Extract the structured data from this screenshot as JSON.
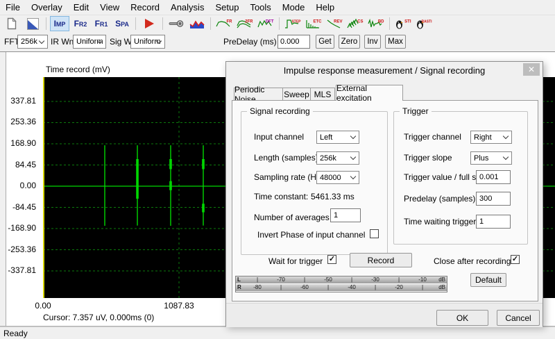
{
  "menu": {
    "items": [
      "File",
      "Overlay",
      "Edit",
      "View",
      "Record",
      "Analysis",
      "Setup",
      "Tools",
      "Mode",
      "Help"
    ]
  },
  "toolbar": {
    "buttons": [
      {
        "kind": "doc",
        "name": "new-document-icon"
      },
      {
        "kind": "scale",
        "name": "scale-icon"
      },
      {
        "kind": "sep"
      },
      {
        "kind": "text",
        "name": "imp-mode-button",
        "label": "IMP",
        "active": true
      },
      {
        "kind": "text",
        "name": "fr2-mode-button",
        "label": "FR2"
      },
      {
        "kind": "text",
        "name": "fr1-mode-button",
        "label": "FR1"
      },
      {
        "kind": "text",
        "name": "spa-mode-button",
        "label": "SPA"
      },
      {
        "kind": "sep"
      },
      {
        "kind": "play",
        "name": "play-record-button"
      },
      {
        "kind": "sep"
      },
      {
        "kind": "mic",
        "name": "microphone-icon"
      },
      {
        "kind": "wave",
        "name": "signal-generator-icon"
      },
      {
        "kind": "sep"
      },
      {
        "kind": "chart",
        "name": "fr-smoothed-button",
        "label": "FR"
      },
      {
        "kind": "chart",
        "name": "fr-overlay-button",
        "label": "2FR"
      },
      {
        "kind": "chart",
        "name": "dft-button",
        "label": "DFT",
        "label_color": "#a000a0"
      },
      {
        "kind": "sep"
      },
      {
        "kind": "chart",
        "name": "step-response-button",
        "label": "STEP"
      },
      {
        "kind": "chart",
        "name": "etc-button",
        "label": "ETC"
      },
      {
        "kind": "chart",
        "name": "reverberation-button",
        "label": "REV"
      },
      {
        "kind": "chart",
        "name": "cumulative-spectrum-button",
        "label": "CS"
      },
      {
        "kind": "chart",
        "name": "burst-decay-button",
        "label": "BD"
      },
      {
        "kind": "sep"
      },
      {
        "kind": "penguin",
        "name": "sti-button",
        "label": "STI"
      },
      {
        "kind": "penguin",
        "name": "rasti-button",
        "label": "RASTI"
      }
    ]
  },
  "settings_bar": {
    "fft_label": "FFT",
    "fft_value": "256k",
    "ir_wnd_label": "IR Wnd",
    "ir_wnd_value": "Uniform",
    "sig_wnd_label": "Sig Wnd",
    "sig_wnd_value": "Uniform",
    "predelay_label": "PreDelay (ms)",
    "predelay_value": "0.000",
    "get_label": "Get",
    "zero_label": "Zero",
    "inv_label": "Inv",
    "max_label": "Max"
  },
  "chart_data": {
    "type": "line",
    "title": "Time record (mV)",
    "xlabel": "",
    "ylabel": "mV",
    "y_ticks": [
      "337.81",
      "253.36",
      "168.90",
      "84.45",
      "0.00",
      "-84.45",
      "-168.90",
      "-253.36",
      "-337.81"
    ],
    "x_ticks": [
      {
        "label": "0.00",
        "frac": 0.0
      },
      {
        "label": "1087.83",
        "frac": 0.2656
      }
    ],
    "ylim": [
      -445,
      434
    ],
    "grid": true,
    "legend": "none",
    "cursor_readout": "Cursor: 7.357 uV, 0.000ms (0)",
    "cursor_frac": 0.0,
    "vertical_gridline_frac": 0.2656,
    "colors": {
      "background": "#000000",
      "grid": "#0c7a0c",
      "trace": "#00d800",
      "cursor": "#d4d400"
    },
    "spikes": [
      {
        "frac": 0.1206,
        "top_mV": 163,
        "bottom_mV": -158,
        "thick": []
      },
      {
        "frac": 0.1843,
        "top_mV": 163,
        "bottom_mV": -157,
        "thick": [
          [
            108,
            -50
          ]
        ]
      },
      {
        "frac": 0.2493,
        "top_mV": 163,
        "bottom_mV": -158,
        "thick": [
          [
            108,
            68
          ],
          [
            20,
            -16
          ]
        ]
      },
      {
        "frac": 0.313,
        "top_mV": 163,
        "bottom_mV": -157,
        "thick": [
          [
            108,
            68
          ],
          [
            -70,
            -104
          ]
        ]
      }
    ]
  },
  "dialog": {
    "title": "Impulse response measurement / Signal recording",
    "close_glyph": "✕",
    "tabs": [
      {
        "label": "Periodic Noise",
        "active": false
      },
      {
        "label": "Sweep",
        "active": false
      },
      {
        "label": "MLS",
        "active": false
      },
      {
        "label": "External excitation",
        "active": true
      }
    ],
    "signal": {
      "title": "Signal recording",
      "rows": [
        {
          "label": "Input channel",
          "value": "Left"
        },
        {
          "label": "Length (samples)",
          "value": "256k"
        },
        {
          "label": "Sampling rate (Hz)",
          "value": "48000"
        },
        {
          "label": "Time constant:",
          "value": "5461.33 ms"
        },
        {
          "label": "Number of averages",
          "value": "1"
        },
        {
          "label": "Invert Phase of input channel",
          "checked": false
        }
      ]
    },
    "trigger": {
      "title": "Trigger",
      "rows": [
        {
          "label": "Trigger channel",
          "value": "Right"
        },
        {
          "label": "Trigger slope",
          "value": "Plus"
        },
        {
          "label": "Trigger value / full scale",
          "value": "0.001"
        },
        {
          "label": "Predelay (samples)",
          "value": "300"
        },
        {
          "label": "Time waiting trigger (s)",
          "value": "1"
        }
      ]
    },
    "wait_for_trigger": {
      "label": "Wait for trigger",
      "checked": true
    },
    "record_button": "Record",
    "close_after_recording": {
      "label": "Close after recording",
      "checked": true
    },
    "meter": {
      "rows": [
        [
          "L",
          "|",
          "-70",
          "|",
          "-50",
          "|",
          "-30",
          "|",
          "-10",
          "dB"
        ],
        [
          "R",
          "-80",
          "|",
          "-60",
          "|",
          "-40",
          "|",
          "-20",
          "|",
          "dB"
        ]
      ]
    },
    "default_button": "Default",
    "ok_button": "OK",
    "cancel_button": "Cancel"
  },
  "status_bar": {
    "text": "Ready"
  }
}
